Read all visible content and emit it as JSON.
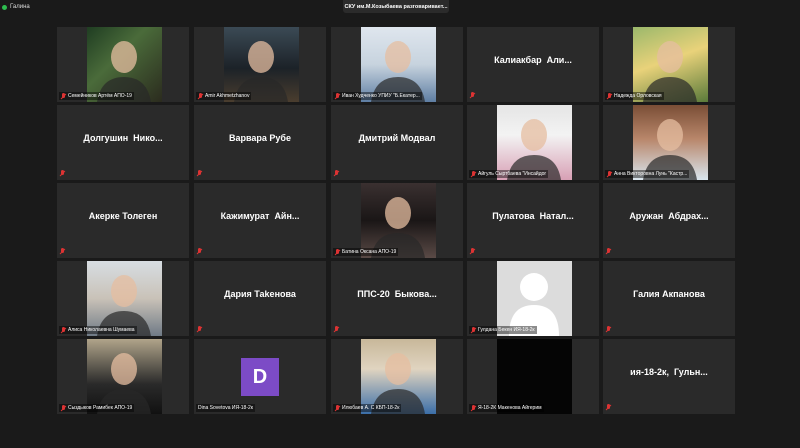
{
  "top_bar": {
    "left_label": "Галина",
    "speaker_banner": "СКУ им.М.Козыбаева разговаривает..."
  },
  "participants": [
    {
      "label": "Семейников Артём АПО-19",
      "muted": true,
      "type": "video"
    },
    {
      "label": "Amir Akhmetzhanov",
      "muted": true,
      "type": "video"
    },
    {
      "label": "Иван Худченко УПИУ \"Б.Екатер...",
      "muted": true,
      "type": "video"
    },
    {
      "name": "Калиакбар  Али...",
      "muted": true,
      "type": "name"
    },
    {
      "label": "Надежда Орловская",
      "muted": true,
      "type": "video"
    },
    {
      "name": "Долгушин  Нико...",
      "muted": true,
      "type": "name"
    },
    {
      "name": "Варвара Рубе",
      "muted": true,
      "type": "name"
    },
    {
      "name": "Дмитрий Модвал",
      "muted": true,
      "type": "name"
    },
    {
      "label": "Айгуль Сыртбаева \"Инсайдог",
      "muted": true,
      "type": "video"
    },
    {
      "label": "Анна Викторовна Лунь \"Кастр...",
      "muted": true,
      "type": "video"
    },
    {
      "name": "Акерке Толеген",
      "muted": true,
      "type": "name"
    },
    {
      "name": "Кажимурат  Айн...",
      "muted": true,
      "type": "name"
    },
    {
      "label": "Батина Оксана АПО-19",
      "muted": true,
      "type": "video"
    },
    {
      "name": "Пулатова  Натал...",
      "muted": true,
      "type": "name"
    },
    {
      "name": "Аружан  Абдрах...",
      "muted": true,
      "type": "name"
    },
    {
      "label": "Алиса Николаевна Шумаева",
      "muted": true,
      "type": "video"
    },
    {
      "name": "Дария Таkенова",
      "muted": true,
      "type": "name"
    },
    {
      "name": "ППС-20  Быкова...",
      "muted": true,
      "type": "name"
    },
    {
      "label": "Гулдана Бекен ИЯ-18-2к",
      "muted": true,
      "type": "photo"
    },
    {
      "name": "Галия Акпанова",
      "muted": true,
      "type": "name"
    },
    {
      "label": "Сыздыков Рамибек АПО-19",
      "muted": true,
      "type": "video"
    },
    {
      "label": "Dina Sovetova ИЯ-18-2к",
      "muted": false,
      "type": "avatar",
      "avatar_letter": "D"
    },
    {
      "label": "Илюбаев А. С  КБП-18-2к",
      "muted": true,
      "type": "video"
    },
    {
      "label": "Я-18-2К Макенова Айгерим",
      "muted": true,
      "type": "dark"
    },
    {
      "name": "ия-18-2к,  Гульн...",
      "muted": true,
      "type": "name"
    }
  ],
  "colors": {
    "background": "#1a1a1a",
    "tile": "#2a2a2a",
    "muted_icon": "#dd3333",
    "avatar": "#7c4bc6"
  }
}
